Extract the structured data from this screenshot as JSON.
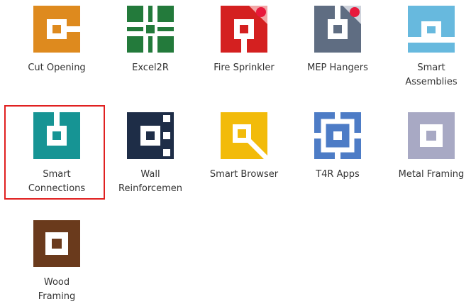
{
  "apps": [
    {
      "label": "Cut Opening",
      "color": "#de8a1e",
      "icon": "cut-opening-icon"
    },
    {
      "label": "Excel2R",
      "color": "#237a3b",
      "icon": "excel2r-icon"
    },
    {
      "label": "Fire Sprinkler",
      "color": "#d42020",
      "icon": "fire-sprinkler-icon"
    },
    {
      "label": "MEP Hangers",
      "color": "#5f6d82",
      "icon": "mep-hangers-icon"
    },
    {
      "label": "Smart\nAssemblies",
      "color": "#67b9de",
      "icon": "smart-assemblies-icon"
    },
    {
      "label": "Smart\nConnections",
      "color": "#169494",
      "icon": "smart-connections-icon",
      "selected": true
    },
    {
      "label": "Wall\nReinforcemen",
      "color": "#1e2d47",
      "icon": "wall-reinforcement-icon"
    },
    {
      "label": "Smart Browser",
      "color": "#f2bb0a",
      "icon": "smart-browser-icon"
    },
    {
      "label": "T4R Apps",
      "color": "#4d7cc6",
      "icon": "t4r-apps-icon"
    },
    {
      "label": "Metal Framing",
      "color": "#a8a9c4",
      "icon": "metal-framing-icon"
    },
    {
      "label": "Wood\nFraming",
      "color": "#6a3a1c",
      "icon": "wood-framing-icon"
    }
  ]
}
